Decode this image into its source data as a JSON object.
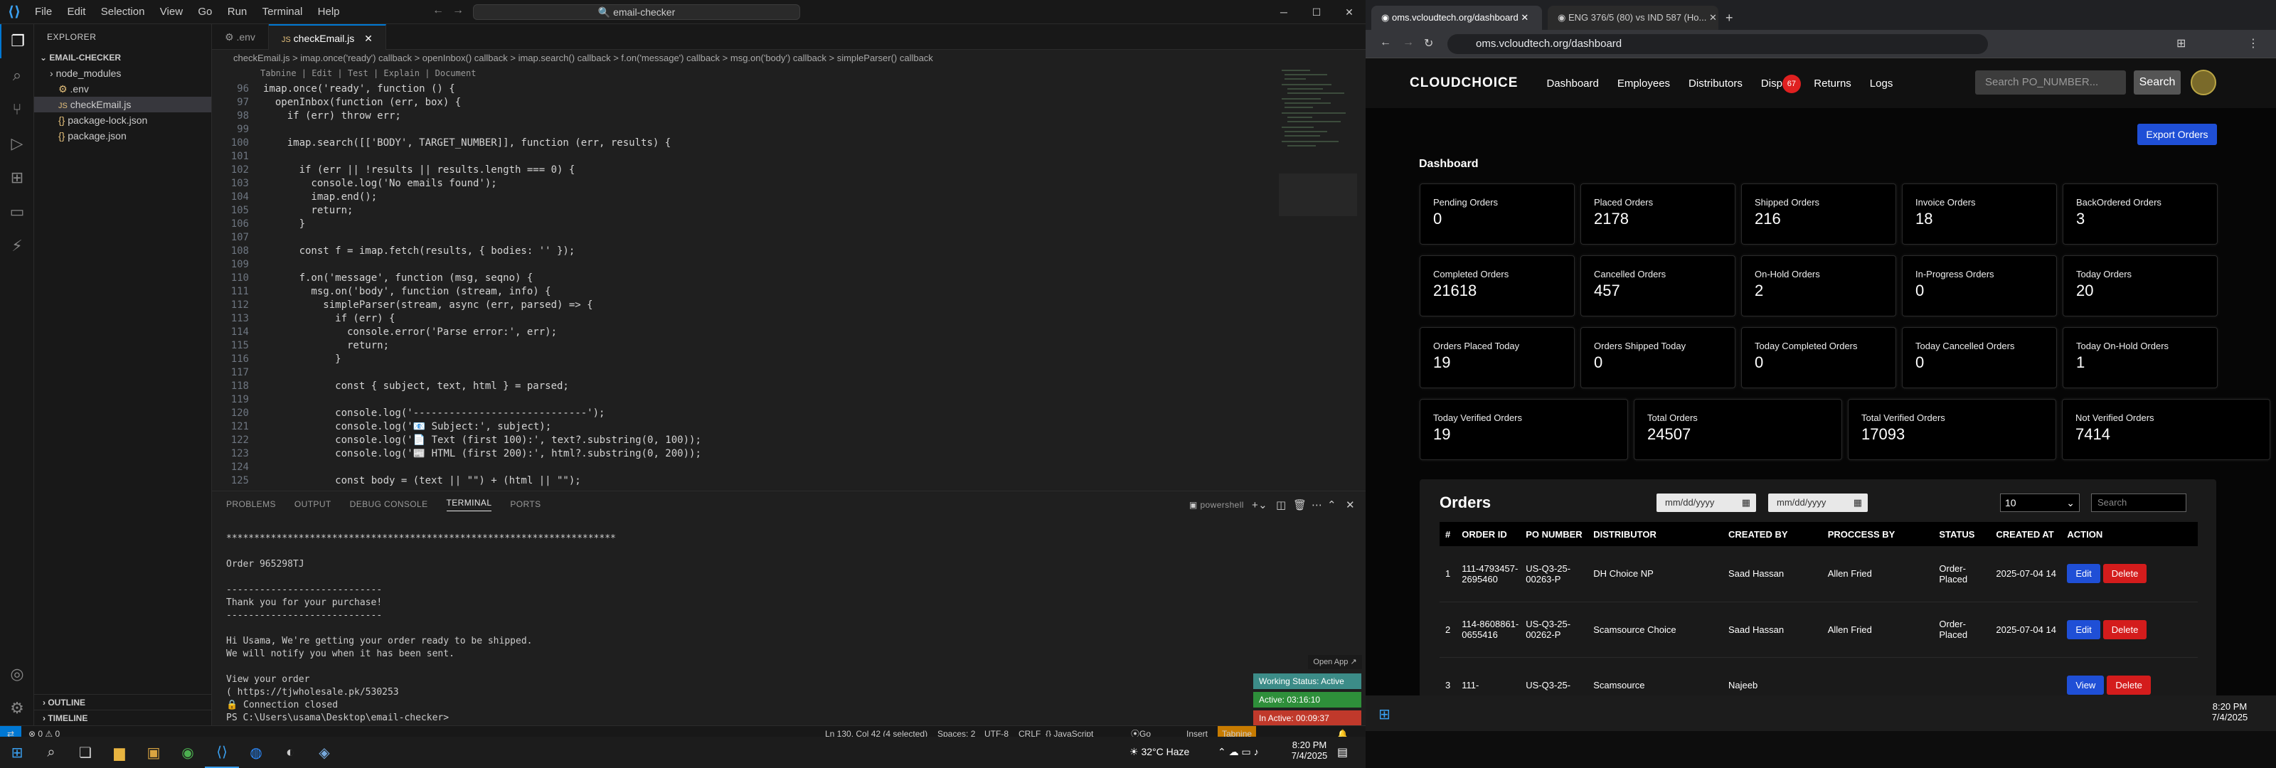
{
  "vscode": {
    "menu": [
      "File",
      "Edit",
      "Selection",
      "View",
      "Go",
      "Run",
      "Terminal",
      "Help"
    ],
    "command_center": "email-checker",
    "explorer": {
      "header": "EXPLORER",
      "folder": "EMAIL-CHECKER",
      "items": [
        "node_modules",
        ".env",
        "checkEmail.js",
        "package-lock.json",
        "package.json"
      ],
      "outline": "OUTLINE",
      "timeline": "TIMELINE"
    },
    "tabs": [
      ".env",
      "checkEmail.js"
    ],
    "breadcrumb": "checkEmail.js > imap.once('ready') callback > openInbox() callback > imap.search() callback > f.on('message') callback > msg.on('body') callback > simpleParser() callback",
    "tabnine": "Tabnine | Edit | Test | Explain | Document",
    "code": [
      {
        "n": "96",
        "t": "imap.once('ready', function () {"
      },
      {
        "n": "97",
        "t": "  openInbox(function (err, box) {"
      },
      {
        "n": "98",
        "t": "    if (err) throw err;"
      },
      {
        "n": "99",
        "t": ""
      },
      {
        "n": "100",
        "t": "    imap.search([['BODY', TARGET_NUMBER]], function (err, results) {"
      },
      {
        "n": "101",
        "t": ""
      },
      {
        "n": "102",
        "t": "      if (err || !results || results.length === 0) {"
      },
      {
        "n": "103",
        "t": "        console.log('No emails found');"
      },
      {
        "n": "104",
        "t": "        imap.end();"
      },
      {
        "n": "105",
        "t": "        return;"
      },
      {
        "n": "106",
        "t": "      }"
      },
      {
        "n": "107",
        "t": ""
      },
      {
        "n": "108",
        "t": "      const f = imap.fetch(results, { bodies: '' });"
      },
      {
        "n": "109",
        "t": ""
      },
      {
        "n": "110",
        "t": "      f.on('message', function (msg, seqno) {"
      },
      {
        "n": "111",
        "t": "        msg.on('body', function (stream, info) {"
      },
      {
        "n": "112",
        "t": "          simpleParser(stream, async (err, parsed) => {"
      },
      {
        "n": "113",
        "t": "            if (err) {"
      },
      {
        "n": "114",
        "t": "              console.error('Parse error:', err);"
      },
      {
        "n": "115",
        "t": "              return;"
      },
      {
        "n": "116",
        "t": "            }"
      },
      {
        "n": "117",
        "t": ""
      },
      {
        "n": "118",
        "t": "            const { subject, text, html } = parsed;"
      },
      {
        "n": "119",
        "t": ""
      },
      {
        "n": "120",
        "t": "            console.log('-----------------------------');"
      },
      {
        "n": "121",
        "t": "            console.log('📧 Subject:', subject);"
      },
      {
        "n": "122",
        "t": "            console.log('📄 Text (first 100):', text?.substring(0, 100));"
      },
      {
        "n": "123",
        "t": "            console.log('📰 HTML (first 200):', html?.substring(0, 200));"
      },
      {
        "n": "124",
        "t": ""
      },
      {
        "n": "125",
        "t": "            const body = (text || \"\") + (html || \"\");"
      }
    ],
    "panel_tabs": [
      "PROBLEMS",
      "OUTPUT",
      "DEBUG CONSOLE",
      "TERMINAL",
      "PORTS"
    ],
    "terminal_shell": "powershell",
    "terminal_lines": [
      "",
      "**********************************************************************",
      "",
      "Order 965298TJ",
      "",
      "----------------------------",
      "Thank you for your purchase!",
      "----------------------------",
      "",
      "Hi Usama, We're getting your order ready to be shipped.",
      "We will notify you when it has been sent.",
      "",
      "View your order",
      "( https://tjwholesale.pk/530253",
      "🔒 Connection closed",
      "PS C:\\Users\\usama\\Desktop\\email-checker> "
    ],
    "open_app": "Open App ↗",
    "working_status": "Working Status: Active",
    "active_time": "Active: 03:16:10",
    "inactive_time": "In Active: 00:09:37",
    "status": {
      "left": "⊗ 0  ⚠ 0",
      "cursor": "Ln 130, Col 42 (4 selected)",
      "spaces": "Spaces: 2",
      "encoding": "UTF-8",
      "eol": "CRLF",
      "language": "{} JavaScript",
      "golive": "Go Live",
      "insert": "Insert",
      "tabnine": "Tabnine"
    },
    "taskbar": {
      "weather": "32°C Haze",
      "time": "8:20 PM",
      "date": "7/4/2025"
    }
  },
  "browser": {
    "tabs": [
      "oms.vcloudtech.org/dashboard",
      "ENG 376/5 (80) vs IND 587 (Ho..."
    ],
    "url": "oms.vcloudtech.org/dashboard",
    "brand": "CLOUDCHOICE",
    "nav": [
      "Dashboard",
      "Employees",
      "Distributors",
      "Dispu",
      "Returns",
      "Logs"
    ],
    "dispute_badge": "67",
    "search_placeholder": "Search PO_NUMBER...",
    "search_button": "Search",
    "export_button": "Export Orders",
    "dashboard_title": "Dashboard",
    "cards": [
      {
        "label": "Pending Orders",
        "value": "0"
      },
      {
        "label": "Placed Orders",
        "value": "2178"
      },
      {
        "label": "Shipped Orders",
        "value": "216"
      },
      {
        "label": "Invoice Orders",
        "value": "18"
      },
      {
        "label": "BackOrdered Orders",
        "value": "3"
      },
      {
        "label": "Completed Orders",
        "value": "21618"
      },
      {
        "label": "Cancelled Orders",
        "value": "457"
      },
      {
        "label": "On-Hold Orders",
        "value": "2"
      },
      {
        "label": "In-Progress Orders",
        "value": "0"
      },
      {
        "label": "Today Orders",
        "value": "20"
      },
      {
        "label": "Orders Placed Today",
        "value": "19"
      },
      {
        "label": "Orders Shipped Today",
        "value": "0"
      },
      {
        "label": "Today Completed Orders",
        "value": "0"
      },
      {
        "label": "Today Cancelled Orders",
        "value": "0"
      },
      {
        "label": "Today On-Hold Orders",
        "value": "1"
      },
      {
        "label": "Today Verified Orders",
        "value": "19"
      },
      {
        "label": "Total Orders",
        "value": "24507"
      },
      {
        "label": "Total Verified Orders",
        "value": "17093"
      },
      {
        "label": "Not Verified Orders",
        "value": "7414"
      }
    ],
    "orders_title": "Orders",
    "date_placeholder": "mm/dd/yyyy",
    "per_page": "10",
    "table_search": "Search",
    "columns": [
      "#",
      "ORDER ID",
      "PO NUMBER",
      "DISTRIBUTOR",
      "CREATED BY",
      "PROCCESS BY",
      "STATUS",
      "CREATED AT",
      "ACTION"
    ],
    "rows": [
      [
        "1",
        "111-4793457-2695460",
        "US-Q3-25-00263-P",
        "DH Choice NP",
        "Saad Hassan",
        "Allen Fried",
        "Order-Placed",
        "2025-07-04 14",
        "Edit",
        "Delete"
      ],
      [
        "2",
        "114-8608861-0655416",
        "US-Q3-25-00262-P",
        "Scamsource Choice",
        "Saad Hassan",
        "Allen Fried",
        "Order-Placed",
        "2025-07-04 14",
        "Edit",
        "Delete"
      ],
      [
        "3",
        "111-",
        "US-Q3-25-",
        "Scamsource",
        "Najeeb",
        "",
        "",
        "",
        "View",
        "Delete"
      ]
    ],
    "taskbar": {
      "time": "8:20 PM",
      "date": "7/4/2025"
    }
  }
}
